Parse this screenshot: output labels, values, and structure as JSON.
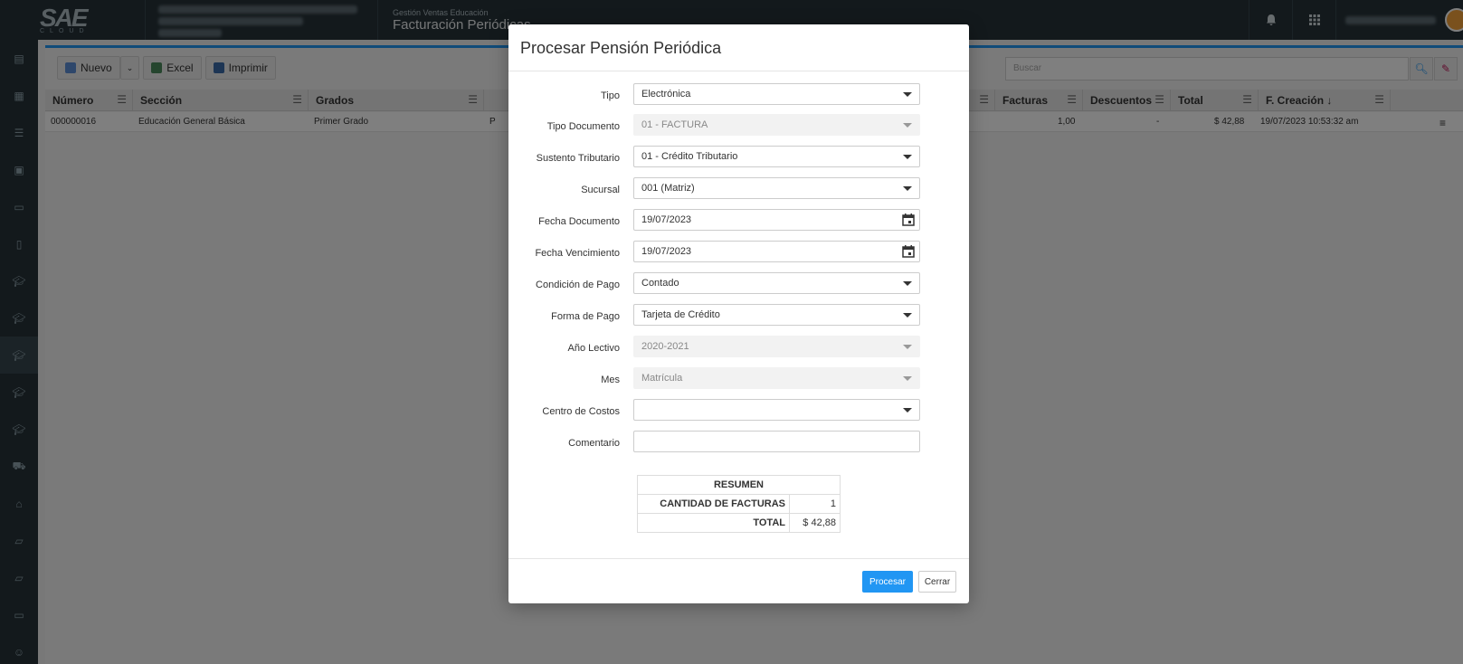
{
  "topbar": {
    "logo_text": "SAE",
    "logo_sub": "CLOUD",
    "module_sub": "Gestión Ventas Educación",
    "module_title": "Facturación Periódicas",
    "bell_icon": "bell-icon",
    "apps_icon": "grid-icon"
  },
  "sidebar": {
    "items": [
      "book-icon",
      "table-icon",
      "list-icon",
      "briefcase-icon",
      "card-icon",
      "document-icon",
      "graduation-icon",
      "graduation-icon",
      "graduation-icon",
      "graduation-icon",
      "graduation-icon",
      "truck-icon",
      "bank-icon",
      "folder-icon",
      "folder-icon",
      "card-icon",
      "users-icon"
    ],
    "active_index": 8
  },
  "toolbar": {
    "new_label": "Nuevo",
    "excel_label": "Excel",
    "print_label": "Imprimir",
    "search_placeholder": "Buscar"
  },
  "grid": {
    "columns": [
      "Número",
      "Sección",
      "Grados",
      "Facturas",
      "Descuentos",
      "Total",
      "F. Creación ↓"
    ],
    "row": {
      "numero": "000000016",
      "seccion": "Educación General Básica",
      "grados": "Primer Grado",
      "extra": "P",
      "facturas": "1,00",
      "descuentos": "-",
      "total": "$ 42,88",
      "creacion": "19/07/2023 10:53:32 am"
    }
  },
  "modal": {
    "title": "Procesar Pensión Periódica",
    "fields": {
      "tipo": {
        "label": "Tipo",
        "value": "Electrónica"
      },
      "tipo_documento": {
        "label": "Tipo Documento",
        "value": "01 - FACTURA"
      },
      "sustento": {
        "label": "Sustento Tributario",
        "value": "01 - Crédito Tributario"
      },
      "sucursal": {
        "label": "Sucursal",
        "value": "001 (Matriz)"
      },
      "fecha_documento": {
        "label": "Fecha Documento",
        "value": "19/07/2023"
      },
      "fecha_vencimiento": {
        "label": "Fecha Vencimiento",
        "value": "19/07/2023"
      },
      "condicion": {
        "label": "Condición de Pago",
        "value": "Contado"
      },
      "forma": {
        "label": "Forma de Pago",
        "value": "Tarjeta de Crédito"
      },
      "anio": {
        "label": "Año Lectivo",
        "value": "2020-2021"
      },
      "mes": {
        "label": "Mes",
        "value": "Matrícula"
      },
      "centro": {
        "label": "Centro de Costos",
        "value": ""
      },
      "comentario": {
        "label": "Comentario",
        "value": ""
      }
    },
    "summary": {
      "header": "RESUMEN",
      "count_label": "CANTIDAD DE FACTURAS",
      "count_value": "1",
      "total_label": "TOTAL",
      "total_value": "$ 42,88"
    },
    "process_label": "Procesar",
    "close_label": "Cerrar"
  }
}
